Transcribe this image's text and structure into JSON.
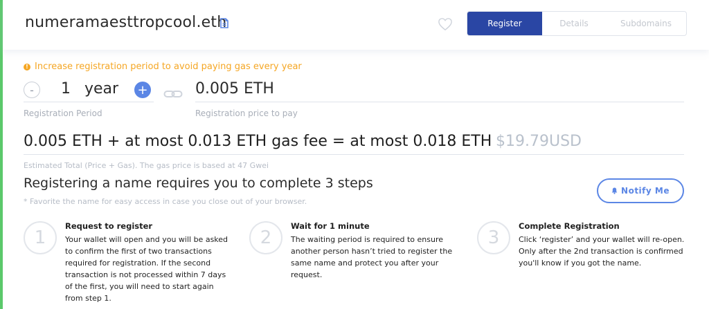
{
  "header": {
    "domain_name": "numeramaesttropcool.eth",
    "tabs": [
      {
        "label": "Register",
        "active": true
      },
      {
        "label": "Details",
        "active": false
      },
      {
        "label": "Subdomains",
        "active": false
      }
    ]
  },
  "registration": {
    "warning": "Increase registration period to avoid paying gas every year",
    "years": "1",
    "years_unit": "year",
    "minus_label": "-",
    "plus_label": "+",
    "period_label": "Registration Period",
    "price": "0.005 ETH",
    "price_label": "Registration price to pay"
  },
  "total": {
    "text": "0.005 ETH + at most 0.013 ETH gas fee = at most 0.018 ETH",
    "usd": "$19.79USD",
    "note": "Estimated Total (Price + Gas). The gas price is based at 47 Gwei"
  },
  "steps_section": {
    "title": "Registering a name requires you to complete 3 steps",
    "note": "* Favorite the name for easy access in case you close out of your browser.",
    "notify_label": "Notify Me",
    "steps": [
      {
        "number": "1",
        "title": "Request to register",
        "body": "Your wallet will open and you will be asked to confirm the first of two transactions required for registration. If the second transaction is not processed within 7 days of the first, you will need to start again from step 1."
      },
      {
        "number": "2",
        "title": "Wait for 1 minute",
        "body": "The waiting period is required to ensure another person hasn’t tried to register the same name and protect you after your request."
      },
      {
        "number": "3",
        "title": "Complete Registration",
        "body": "Click ‘register’ and your wallet will re-open. Only after the 2nd transaction is confirmed you'll know if you got the name."
      }
    ]
  },
  "colors": {
    "accent_blue": "#2a46a4",
    "button_blue": "#5b86e5",
    "warning_orange": "#f5a623",
    "left_accent_green": "#5bc96b"
  },
  "icons": [
    "copy-icon",
    "heart-icon",
    "warning-icon",
    "link-icon",
    "bell-icon"
  ]
}
